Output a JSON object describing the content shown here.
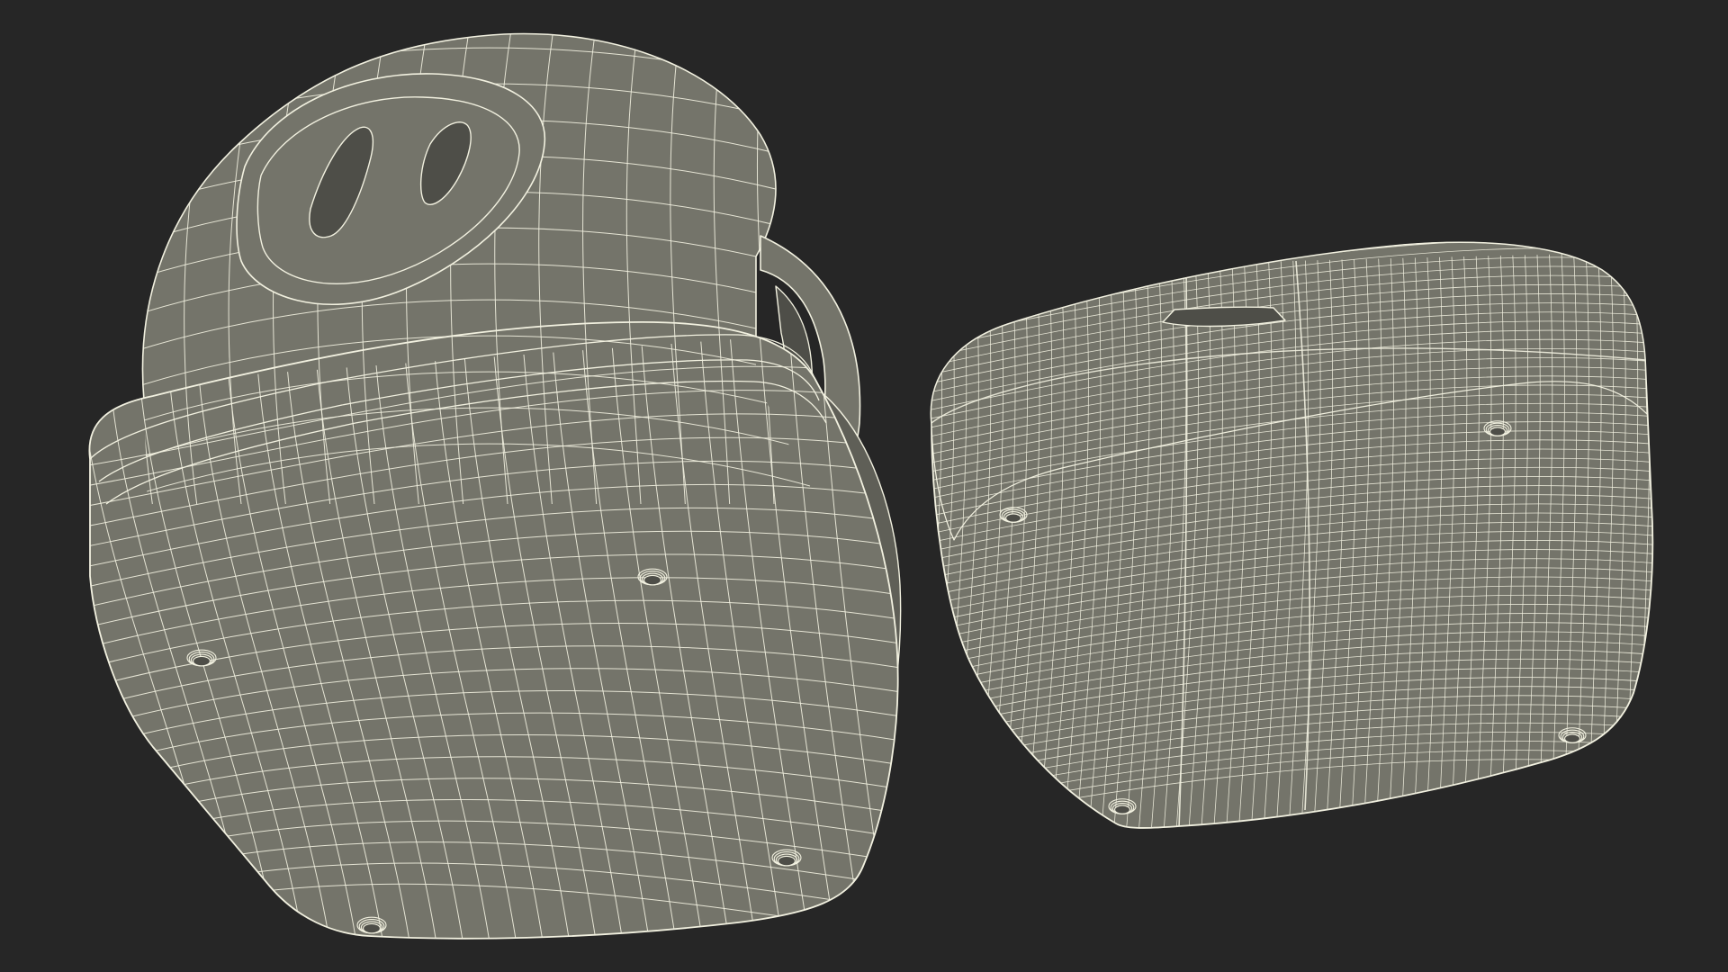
{
  "scene": {
    "background_color": "#262626",
    "surface_color": "#74746a",
    "surface_shadow_color": "#5f5f57",
    "surface_dark_color": "#4e4e48",
    "wire_color": "#f2f1e0",
    "objects": [
      {
        "name": "case-body-wireframe"
      },
      {
        "name": "case-lid-wireframe"
      }
    ]
  }
}
